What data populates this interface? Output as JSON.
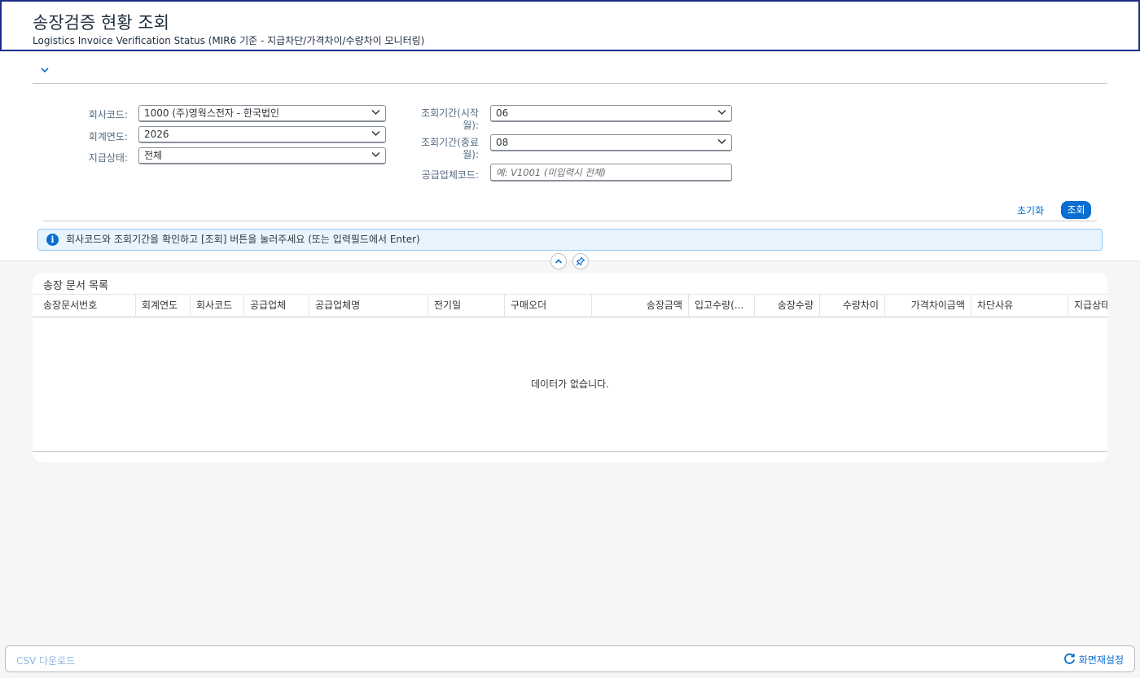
{
  "header": {
    "title": "송장검증 현황 조회",
    "subtitle": "Logistics Invoice Verification Status (MIR6 기준 - 지급차단/가격차이/수량차이 모니터링)"
  },
  "filters": {
    "company_code": {
      "label": "회사코드:",
      "value": "1000 (주)영웍스전자 - 한국법인"
    },
    "fiscal_year": {
      "label": "회계연도:",
      "value": "2026"
    },
    "payment_status": {
      "label": "지급상태:",
      "value": "전체"
    },
    "period_from": {
      "label_line1": "조회기간(시작",
      "label_line2": "월):",
      "value": "06"
    },
    "period_to": {
      "label_line1": "조회기간(종료",
      "label_line2": "월):",
      "value": "08"
    },
    "vendor_code": {
      "label": "공급업체코드:",
      "placeholder": "예: V1001 (미입력시 전체)"
    }
  },
  "actions": {
    "reset_label": "초기화",
    "search_label": "조회"
  },
  "message": {
    "text": "회사코드와 조회기간을 확인하고 [조회] 버튼을 눌러주세요 (또는 입력필드에서 Enter)"
  },
  "table": {
    "title": "송장 문서 목록",
    "columns": [
      "송장문서번호",
      "회계연도",
      "회사코드",
      "공급업체",
      "공급업체명",
      "전기일",
      "구매오더",
      "송장금액",
      "입고수량(...",
      "송장수량",
      "수량차이",
      "가격차이금액",
      "차단사유",
      "지급상태"
    ],
    "empty_text": "데이터가 없습니다."
  },
  "footer": {
    "csv_label": "CSV 다운로드",
    "reset_view_label": "화면재설정"
  },
  "colors": {
    "accent": "#0a6ed1",
    "header_border": "#1a2d8a",
    "info_bg": "#e8f5fe"
  }
}
